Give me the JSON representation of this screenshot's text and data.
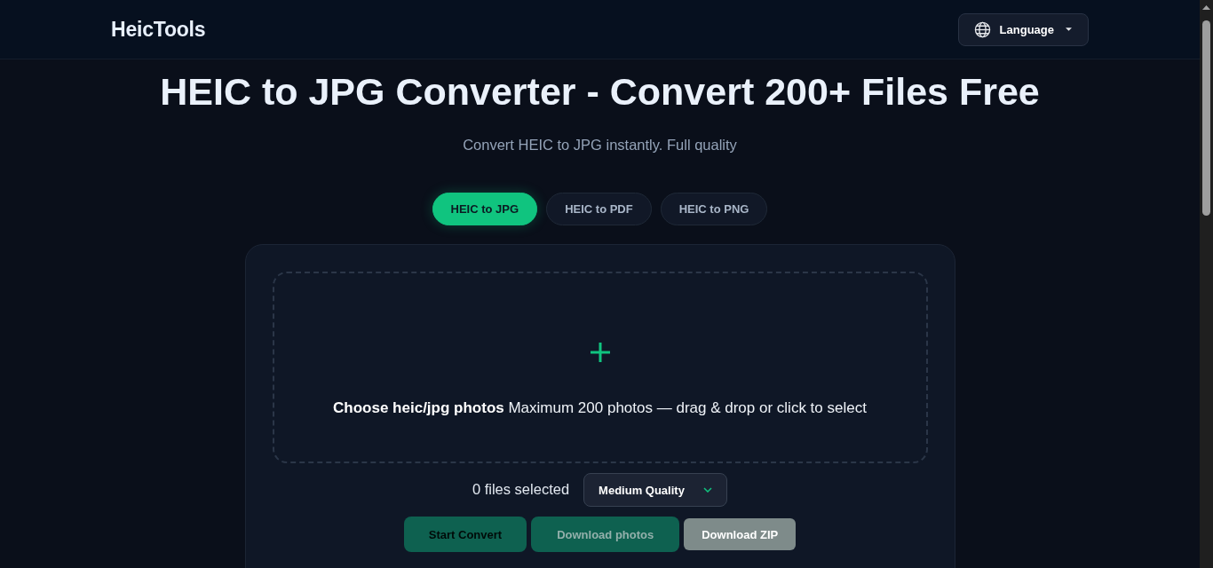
{
  "header": {
    "logo": "HeicTools",
    "language_button": "Language"
  },
  "hero": {
    "title": "HEIC to JPG Converter - Convert 200+ Files Free",
    "subtitle": "Convert HEIC to JPG instantly. Full quality"
  },
  "tabs": [
    {
      "label": "HEIC to JPG",
      "selected": true
    },
    {
      "label": "HEIC to PDF",
      "selected": false
    },
    {
      "label": "HEIC to PNG",
      "selected": false
    }
  ],
  "dropzone": {
    "text": "**Choose heic/jpg photos** Maximum 200 photos — drag & drop or click to select"
  },
  "file_count": "0 files selected",
  "quality_select": {
    "value": "Medium Quality"
  },
  "buttons": [
    {
      "label": "Start Convert",
      "kind": "convert",
      "disabled": true
    },
    {
      "label": "Download photos",
      "kind": "download",
      "disabled": true
    },
    {
      "label": "Download ZIP",
      "kind": "zip",
      "disabled": true
    }
  ]
}
